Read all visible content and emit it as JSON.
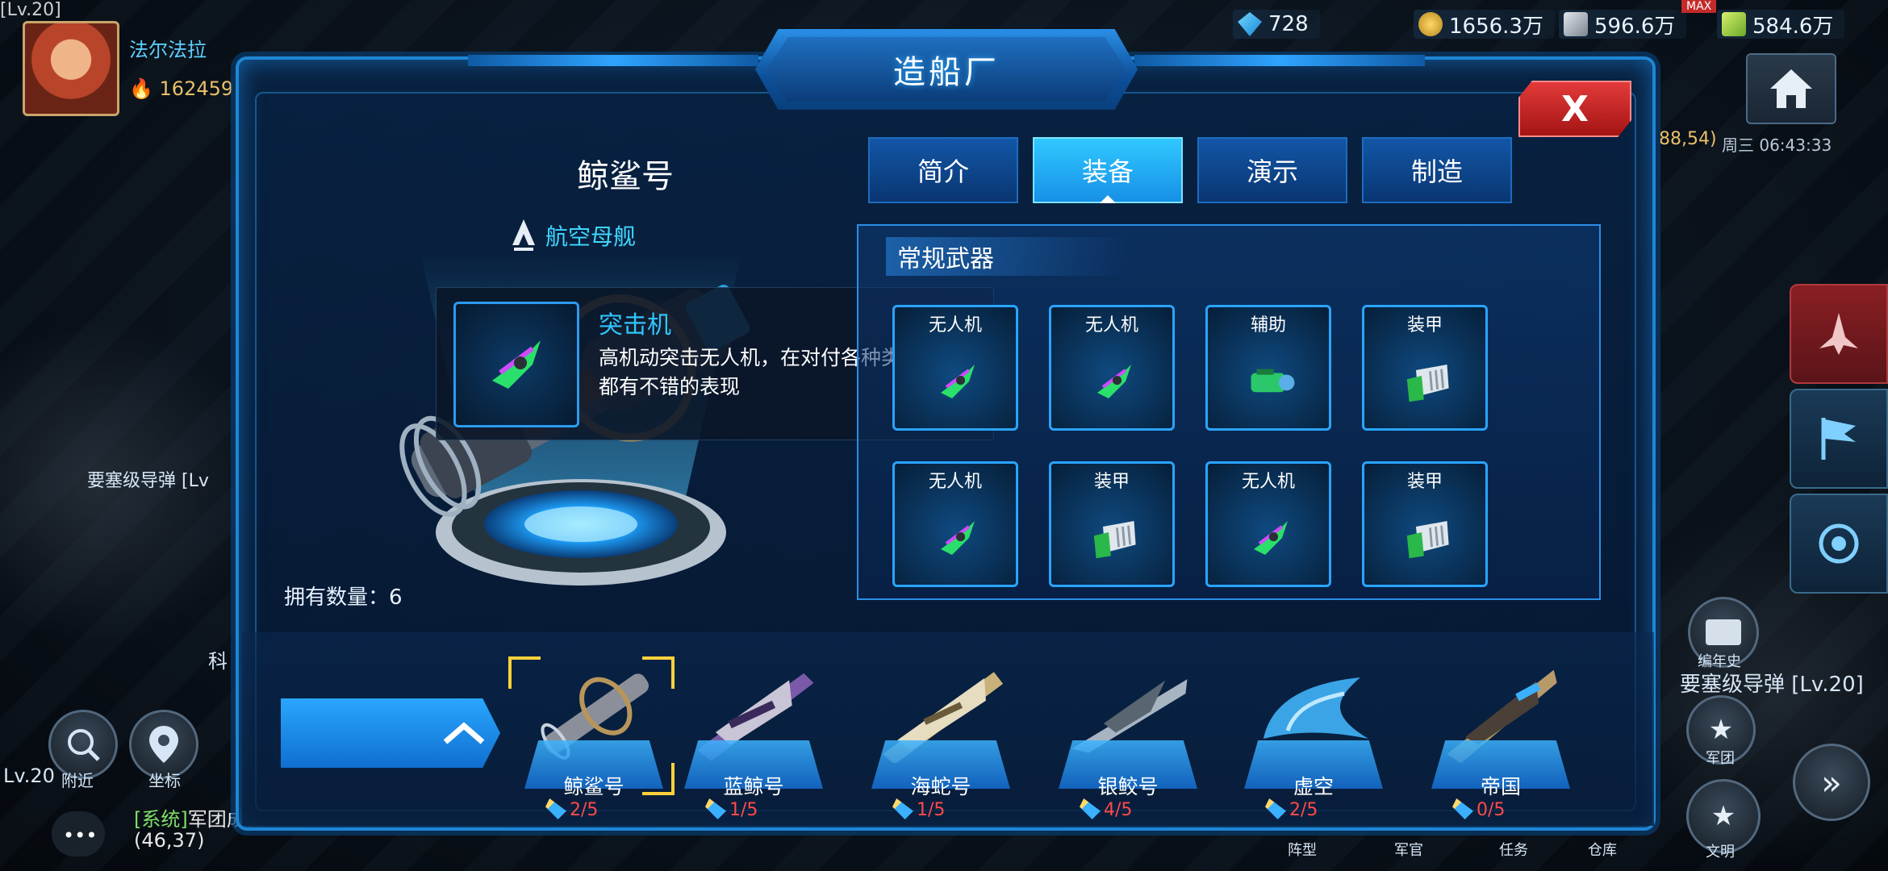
{
  "hud": {
    "player_name": "法尔法拉",
    "power": "162459",
    "top_level": "[Lv.20]",
    "resources": [
      {
        "icon": "diamond-icon",
        "value": "728"
      },
      {
        "icon": "gold-coin-icon",
        "value": "1656.3万"
      },
      {
        "icon": "metal-icon",
        "value": "596.6万",
        "badge": "MAX"
      },
      {
        "icon": "crystal-icon",
        "value": "584.6万"
      }
    ],
    "coord": "88,54)",
    "date_time": "周三 06:43:33",
    "left_map_label": "要塞级导弹 [Lv",
    "right_map_label": "要塞级导弹 [Lv.20]",
    "right_history": "编年史",
    "bottom_left": {
      "level": "Lv.20",
      "nearby": "附近",
      "coord": "坐标",
      "sci": "科"
    },
    "chat_system": "[系统]",
    "chat_text": "军团成员",
    "chat_coord": "(46,37)",
    "bottom_right_labels": [
      "军团",
      "阵型",
      "军官",
      "任务",
      "仓库",
      "文明"
    ]
  },
  "dialog": {
    "title": "造船厂",
    "close_label": "X",
    "ship": {
      "name": "鲸鲨号",
      "class_label": "航空母舰",
      "owned_label": "拥有数量：6"
    },
    "tooltip": {
      "title": "突击机",
      "desc": "高机动突击无人机，在对付各种类型的战舰都有不错的表现"
    },
    "tabs": [
      {
        "label": "简介",
        "active": false
      },
      {
        "label": "装备",
        "active": true
      },
      {
        "label": "演示",
        "active": false
      },
      {
        "label": "制造",
        "active": false
      }
    ],
    "equipment": {
      "header": "常规武器",
      "slots": [
        {
          "label": "无人机",
          "icon": "drone-icon"
        },
        {
          "label": "无人机",
          "icon": "drone-icon"
        },
        {
          "label": "辅助",
          "icon": "support-module-icon"
        },
        {
          "label": "装甲",
          "icon": "armor-plate-icon"
        },
        {
          "label": "无人机",
          "icon": "drone-icon"
        },
        {
          "label": "装甲",
          "icon": "armor-plate-icon"
        },
        {
          "label": "无人机",
          "icon": "drone-icon"
        },
        {
          "label": "装甲",
          "icon": "armor-plate-icon"
        }
      ]
    },
    "ships": [
      {
        "name": "鲸鲨号",
        "count": "2/5",
        "selected": true,
        "color": "#8a8f99"
      },
      {
        "name": "蓝鲸号",
        "count": "1/5",
        "selected": false,
        "color": "#7a5aa8"
      },
      {
        "name": "海蛇号",
        "count": "1/5",
        "selected": false,
        "color": "#c9b27a"
      },
      {
        "name": "银鲛号",
        "count": "4/5",
        "selected": false,
        "color": "#a7b4c2"
      },
      {
        "name": "虚空",
        "count": "2/5",
        "selected": false,
        "color": "#3aa4e6"
      },
      {
        "name": "帝国",
        "count": "0/5",
        "selected": false,
        "color": "#b89a6a"
      }
    ]
  },
  "colors": {
    "accent": "#1e86d6",
    "active_tab": "#31c8ff",
    "close": "#e23a3a",
    "count_red": "#ff4a4a",
    "gold": "#ffd23a"
  }
}
